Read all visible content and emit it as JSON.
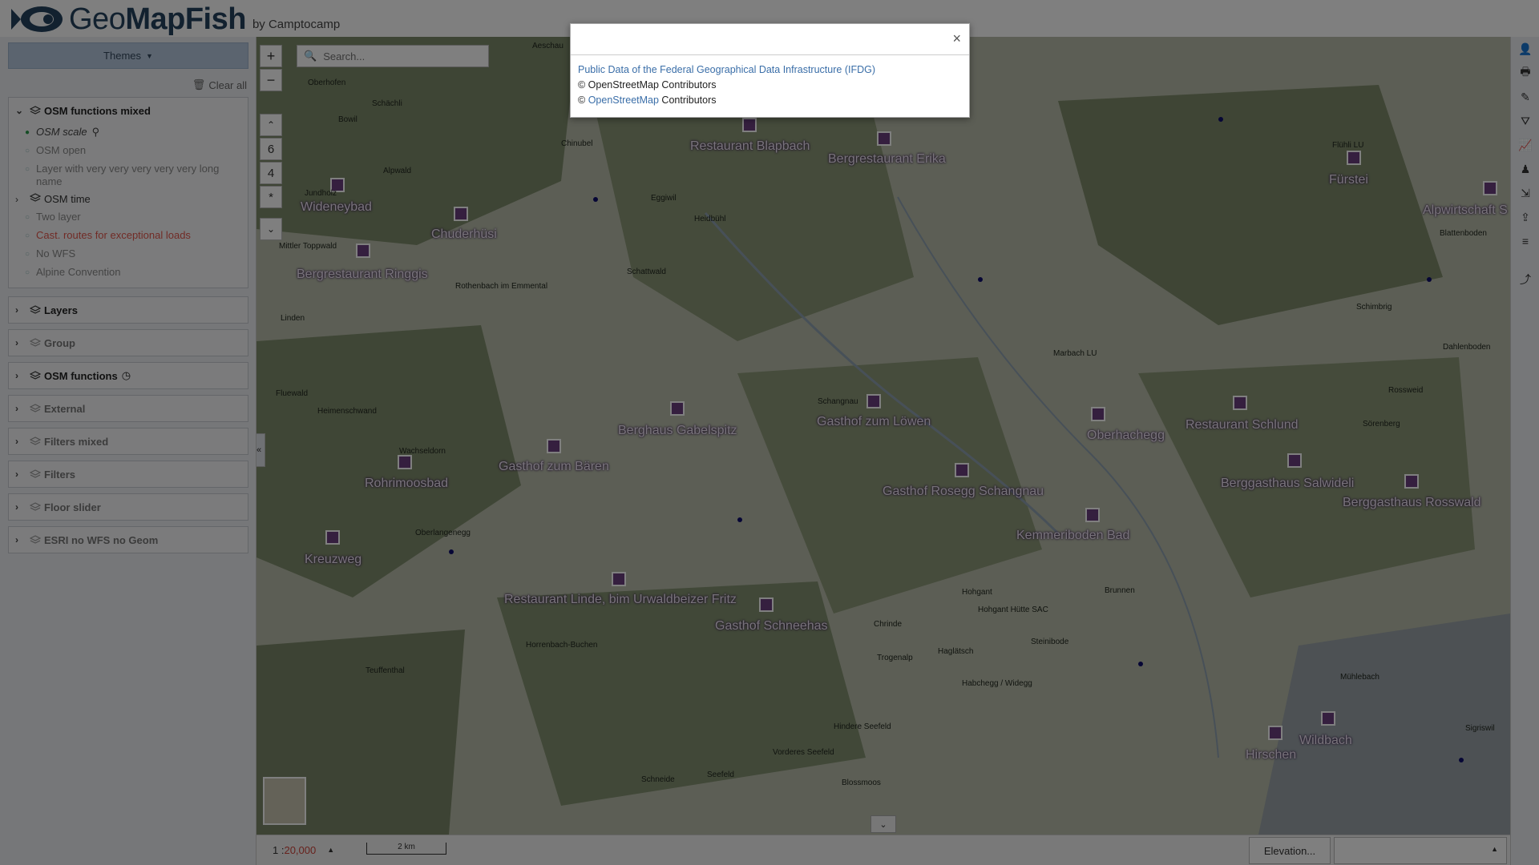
{
  "header": {
    "logo_main": "Geo",
    "logo_bold": "MapFish",
    "logo_by": "by Camptocamp"
  },
  "leftpanel": {
    "themes_label": "Themes",
    "clear_all": "Clear all",
    "group_osm_mixed": {
      "title": "OSM functions mixed",
      "items": [
        {
          "label": "OSM scale"
        },
        {
          "label": "OSM open"
        },
        {
          "label": "Layer with very very very very very long name"
        },
        {
          "label": "OSM time"
        },
        {
          "label": "Two layer"
        },
        {
          "label": "Cast. routes for exceptional loads"
        },
        {
          "label": "No WFS"
        },
        {
          "label": "Alpine Convention"
        }
      ]
    },
    "groups": [
      {
        "label": "Layers"
      },
      {
        "label": "Group"
      },
      {
        "label": "OSM functions"
      },
      {
        "label": "External"
      },
      {
        "label": "Filters mixed"
      },
      {
        "label": "Filters"
      },
      {
        "label": "Floor slider"
      },
      {
        "label": "ESRI no WFS no Geom"
      }
    ]
  },
  "map": {
    "search_placeholder": "Search...",
    "zoom_in": "+",
    "zoom_out": "−",
    "floor_values": [
      "6",
      "4",
      "*"
    ],
    "labels": [
      "Restaurant Blapbach",
      "Bergrestaurant Erika",
      "Wideneybad",
      "Chuderhüsi",
      "Bergrestaurant Ringgis",
      "Berghaus Gabelspitz",
      "Gasthof zum Löwen",
      "Oberhachegg",
      "Restaurant Schlund",
      "Gasthof zum Bären",
      "Rohrimoosbad",
      "Gasthof Rosegg Schangnau",
      "Berggasthaus Salwideli",
      "Berggasthaus Rosswald",
      "Kemmeriboden Bad",
      "Kreuzweg",
      "Restaurant Linde, bim Urwaldbeizer Fritz",
      "Gasthof Schneehas",
      "Fürstei",
      "Alpwirtschaft S",
      "Hirschen",
      "Wildbach"
    ],
    "places": [
      "Aeschau",
      "Oberhofen",
      "Schächli",
      "Bowil",
      "Chinubel",
      "Alpwald",
      "Heidbühl",
      "Eggiwil",
      "Jundholz",
      "Schattwald",
      "Mittler Toppwald",
      "Rothenbach im Emmental",
      "Linden",
      "Heimenschwand",
      "Fluewald",
      "Wachseldorn",
      "Oberlangenegg",
      "Teuffenthal",
      "Horrenbach-Buchen",
      "Chrinde",
      "Trogenalp",
      "Haglätsch",
      "Hohgant",
      "Brunnen",
      "Schangnau",
      "Marbach LU",
      "Flühli LU",
      "Sörenberg",
      "Rossweid",
      "Blattenboden",
      "Dahlenboden",
      "Schimbrig",
      "Seefeld",
      "Hindere Seefeld",
      "Vorderes Seefeld",
      "Blossmoos",
      "Schneide",
      "Hohgant Hütte SAC",
      "Steinibode",
      "Mühlebach",
      "Habchegg / Widegg",
      "Sigriswil"
    ]
  },
  "modal": {
    "close": "×",
    "link_ifdg": "Public Data of the Federal Geographical Data Infrastructure (IFDG)",
    "line2": "© OpenStreetMap Contributors",
    "line3_prefix": "© ",
    "line3_link": "OpenStreetMap",
    "line3_suffix": " Contributors"
  },
  "bottom": {
    "scale_prefix": "1 : ",
    "scale_value": "20,000",
    "scalebar": "2 km",
    "elevation": "Elevation..."
  }
}
